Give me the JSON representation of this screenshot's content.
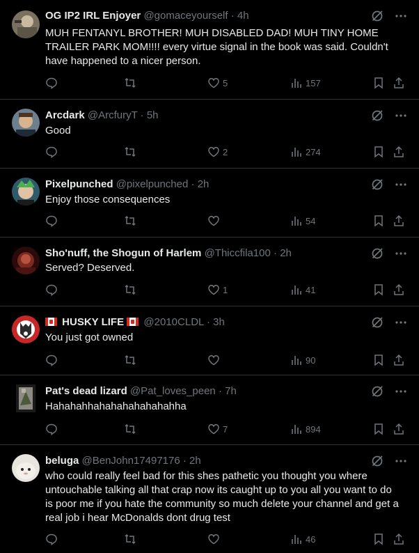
{
  "accent": "#1d9bf0",
  "replies": [
    {
      "name": "OG IP2 IRL Enjoyer",
      "handle": "@gomaceyourself",
      "time": "4h",
      "text": "MUH FENTANYL BROTHER! MUH DISABLED DAD! MUH TINY HOME TRAILER PARK MOM!!!! every virtue signal in the book was said. Couldn't have happened to a nicer person.",
      "likes": "5",
      "views": "157",
      "avatar_icon": "avatar-icon"
    },
    {
      "name": "Arcdark",
      "handle": "@ArcfuryT",
      "time": "5h",
      "text": "Good",
      "likes": "2",
      "views": "274",
      "avatar_icon": "avatar-icon"
    },
    {
      "name": "Pixelpunched",
      "handle": "@pixelpunched",
      "time": "2h",
      "text": "Enjoy those consequences",
      "likes": "",
      "views": "54",
      "avatar_icon": "avatar-icon"
    },
    {
      "name": "Sho'nuff, the Shogun of Harlem",
      "handle": "@Thiccfila100",
      "time": "2h",
      "text": "Served? Deserved.",
      "likes": "1",
      "views": "41",
      "avatar_icon": "avatar-icon"
    },
    {
      "name": "HUSKY LIFE",
      "handle": "@2010CLDL",
      "time": "3h",
      "text": "You just got owned",
      "likes": "",
      "views": "90",
      "avatar_icon": "avatar-icon",
      "flags": [
        "canada-flag-icon",
        "canada-flag-icon"
      ]
    },
    {
      "name": "Pat's dead lizard",
      "handle": "@Pat_loves_peen",
      "time": "7h",
      "text": "Hahahahhahahahahahahahha",
      "likes": "7",
      "views": "894",
      "avatar_icon": "avatar-icon"
    },
    {
      "name": "beluga",
      "handle": "@BenJohn17497176",
      "time": "2h",
      "text": "who could really feel bad for this shes pathetic you thought you where untouchable talking all that crap now its caught up to you all you want to do is poor me if you hate the community so much delete your channel and get a real job i hear McDonalds dont drug test",
      "likes": "",
      "views": "46",
      "avatar_icon": "avatar-icon"
    }
  ]
}
